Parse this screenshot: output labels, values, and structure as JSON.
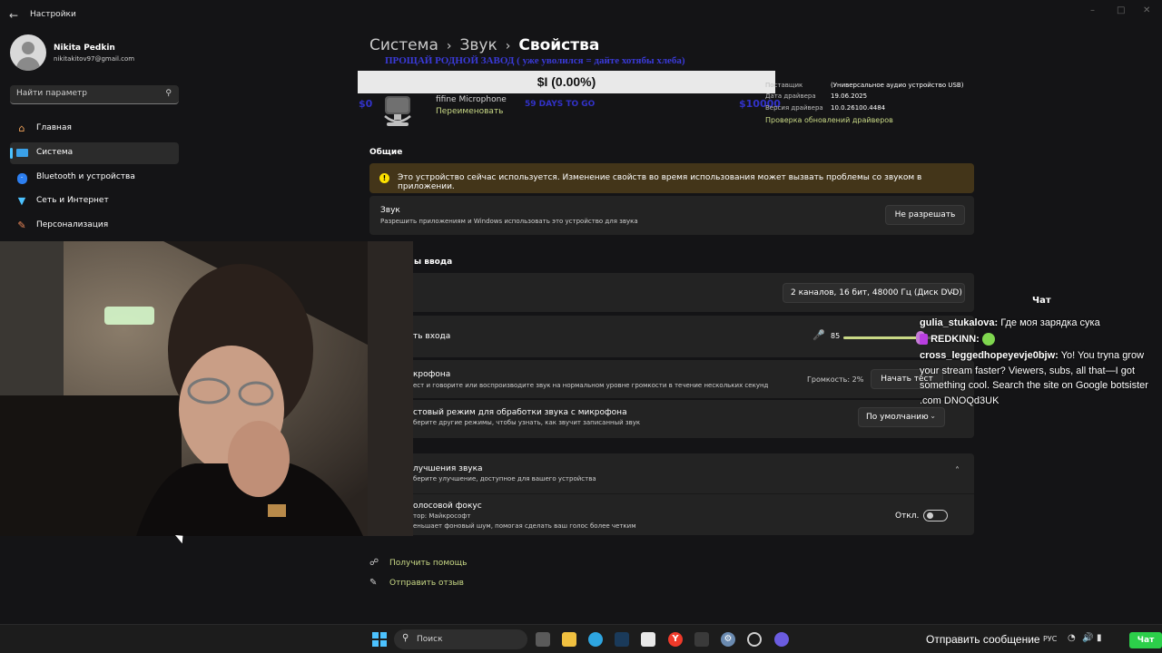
{
  "window": {
    "title": "Настройки",
    "back_icon": "back-arrow-icon"
  },
  "user": {
    "name": "Nikita Pedkin",
    "email": "nikitakitov97@gmail.com"
  },
  "search": {
    "placeholder": "Найти параметр"
  },
  "sidebar": {
    "items": [
      {
        "label": "Главная",
        "icon": "home-icon",
        "active": false
      },
      {
        "label": "Система",
        "icon": "system-icon",
        "active": true
      },
      {
        "label": "Bluetooth и устройства",
        "icon": "bluetooth-icon",
        "active": false
      },
      {
        "label": "Сеть и Интернет",
        "icon": "network-icon",
        "active": false
      },
      {
        "label": "Персонализация",
        "icon": "brush-icon",
        "active": false
      }
    ]
  },
  "breadcrumb": {
    "part1": "Система",
    "part2": "Звук",
    "current": "Свойства"
  },
  "donation_goal": {
    "title": "ПРОЩАЙ РОДНОЙ ЗАВОД ( уже уволился = дайте хотябы хлеба)",
    "bar_text": "$I (0.00%)",
    "progress_fraction": 0.0,
    "min": "$0",
    "days_left": "59 DAYS TO GO",
    "max": "$10000"
  },
  "device": {
    "name": "fifine Microphone",
    "rename": "Переименовать",
    "provider_label": "Поставщик",
    "provider_value": "(Универсальное аудио устройство USB)",
    "driver_date_label": "Дата драйвера",
    "driver_date_value": "19.06.2025",
    "driver_version_label": "Версия драйвера",
    "driver_version_value": "10.0.26100.4484",
    "driver_update_link": "Проверка обновлений драйверов"
  },
  "general": {
    "section_title": "Общие",
    "warning": "Это устройство сейчас используется. Изменение свойств во время использования может вызвать проблемы со звуком в приложении.",
    "sound_title": "Звук",
    "sound_sub": "Разрешить приложениям и Windows использовать это устройство для звука",
    "sound_button": "Не разрешать"
  },
  "input": {
    "section_title": "ы ввода",
    "format_value": "2 каналов, 16 бит, 48000 Гц (Диск DVD)",
    "volume_label": "ть входа",
    "volume_value": "85",
    "volume_fraction": 0.85,
    "test_title": "крофона",
    "test_sub": "ест и говорите или воспроизводите звук на нормальном уровне громкости в течение нескольких секунд",
    "test_level": "Громкость: 2%",
    "test_button": "Начать тест",
    "mode_title": "стовый режим для обработки звука с микрофона",
    "mode_sub": "берите другие режимы, чтобы узнать, как звучит записанный звук",
    "mode_value": "По умолчанию",
    "enh_title": "лучшения звука",
    "enh_sub": "берите улучшение, доступное для вашего устройства",
    "focus_title": "олосовой фокус",
    "focus_author": "тор: Майкрософт",
    "focus_sub": "еньшает фоновый шум, помогая сделать ваш голос более четким",
    "focus_state": "Откл."
  },
  "help": {
    "get_help": "Получить помощь",
    "feedback": "Отправить отзыв"
  },
  "chat": {
    "header": "Чат",
    "messages": [
      {
        "user": "gulia_stukalova:",
        "text": "Где моя зарядка сука"
      },
      {
        "user": "REDKINN:",
        "text": ""
      },
      {
        "user": "cross_leggedhopeyevje0bjw:",
        "text": "Yo! You tryna grow your stream faster? Viewers, subs, all that—I got something cool. Search the site on Google botsister .com DNOQd3UK"
      }
    ],
    "send_placeholder": "Отправить сообщение",
    "send_button": "Чат"
  },
  "taskbar": {
    "search_label": "Поиск",
    "lang": "РУС"
  }
}
